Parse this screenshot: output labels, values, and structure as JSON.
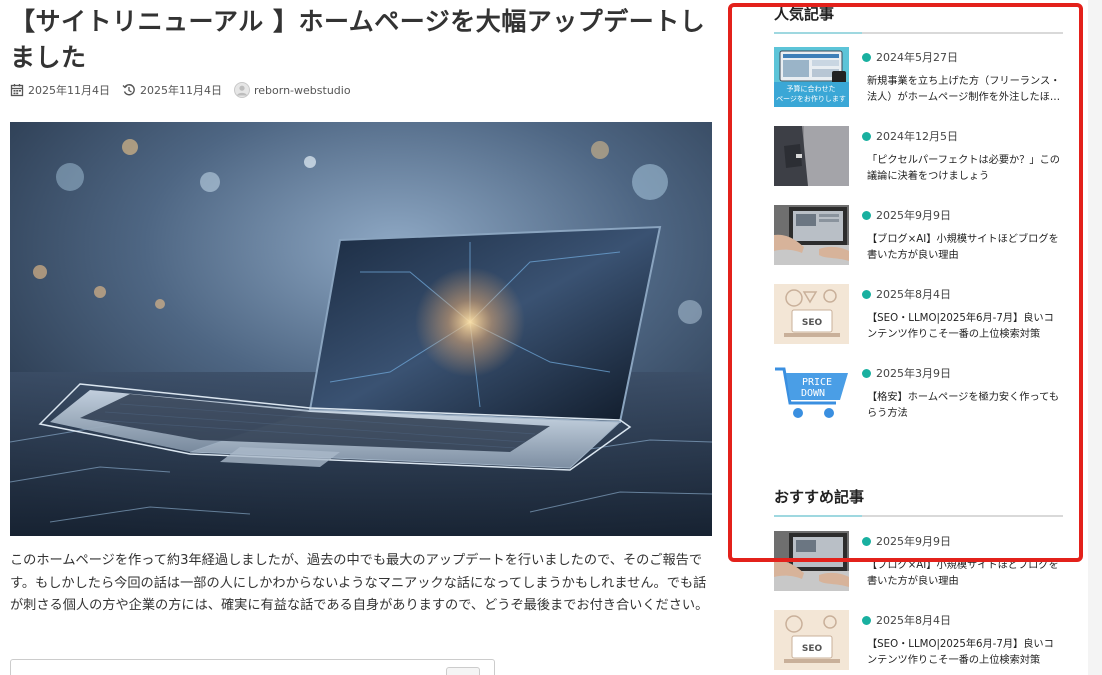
{
  "article": {
    "title": "【サイトリニューアル 】ホームページを大幅アップデートしました",
    "published": "2025年11月4日",
    "updated": "2025年11月4日",
    "author": "reborn-webstudio",
    "hero_icon": "laptop-circuit-image",
    "body": "このホームページを作って約3年経過しましたが、過去の中でも最大のアップデートを行いましたので、そのご報告です。もしかしたら今回の話は一部の人にしかわからないようなマニアックな話になってしまうかもしれません。でも話が刺さる個人の方や企業の方には、確実に有益な話である自身がありますので、どうぞ最後までお付き合いください。"
  },
  "sidebar": {
    "popular": {
      "heading": "人気記事",
      "items": [
        {
          "date": "2024年5月27日",
          "title": "新規事業を立ち上げた方（フリーランス・法人）がホームページ制作を外注したほ…",
          "thumb_text": [
            "予算に合わせた",
            "ページをお作りします"
          ]
        },
        {
          "date": "2024年12月5日",
          "title": "「ピクセルパーフェクトは必要か？」この議論に決着をつけましょう"
        },
        {
          "date": "2025年9月9日",
          "title": "【ブログ×AI】小規模サイトほどブログを書いた方が良い理由"
        },
        {
          "date": "2025年8月4日",
          "title": "【SEO・LLMO|2025年6月-7月】良いコンテンツ作りこそ一番の上位検索対策",
          "thumb_text": [
            "SEO"
          ]
        },
        {
          "date": "2025年3月9日",
          "title": "【格安】ホームページを極力安く作ってもらう方法",
          "thumb_text": [
            "PRICE",
            "DOWN"
          ]
        }
      ]
    },
    "recommended": {
      "heading": "おすすめ記事",
      "items": [
        {
          "date": "2025年9月9日",
          "title": "【ブログ×AI】小規模サイトほどブログを書いた方が良い理由"
        },
        {
          "date": "2025年8月4日",
          "title": "【SEO・LLMO|2025年6月-7月】良いコンテンツ作りこそ一番の上位検索対策",
          "thumb_text": [
            "SEO"
          ]
        }
      ]
    }
  },
  "colors": {
    "accent_dot": "#19b0a0",
    "highlight_border": "#e3211b",
    "heading_rule_accent": "#9fd8e0"
  }
}
